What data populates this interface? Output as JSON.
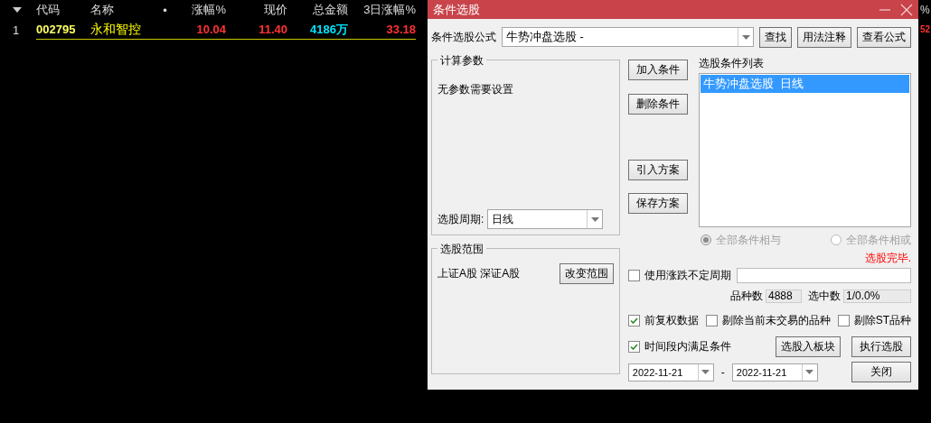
{
  "table": {
    "columns": [
      "代码",
      "名称",
      "•",
      "涨幅%",
      "现价",
      "总金额",
      "3日涨幅%"
    ],
    "rows": [
      {
        "index": "1",
        "cells": [
          "002795",
          "永和智控",
          "",
          "10.04",
          "11.40",
          "4186万",
          "33.18"
        ]
      }
    ],
    "column_8": {
      "header": "%",
      "value": "52"
    }
  },
  "dialog": {
    "title": "条件选股",
    "formula_label": "条件选股公式",
    "formula_value": "牛势冲盘选股 -",
    "top_buttons": [
      "查找",
      "用法注释",
      "查看公式"
    ],
    "params_group": {
      "title": "计算参数",
      "text": "无参数需要设置",
      "period_label": "选股周期:",
      "period_value": "日线"
    },
    "action_buttons": [
      "加入条件",
      "删除条件",
      "引入方案",
      "保存方案"
    ],
    "conditions": {
      "label": "选股条件列表",
      "items": [
        {
          "text": "牛势冲盘选股  日线",
          "selected": true
        }
      ]
    },
    "logic_disabled": true,
    "logic_options": [
      {
        "label": "全部条件相与",
        "selected": true
      },
      {
        "label": "全部条件相或",
        "selected": false
      }
    ],
    "status": "选股完毕.",
    "range_group": {
      "title": "选股范围",
      "text": "上证A股 深证A股",
      "button": "改变范围"
    },
    "variable_period": {
      "label": "使用涨跌不定周期",
      "checked": false
    },
    "counts": [
      {
        "label": "品种数",
        "value": "4888"
      },
      {
        "label": "选中数",
        "value": "1/0.0%"
      }
    ],
    "options": [
      {
        "label": "前复权数据",
        "checked": true
      },
      {
        "label": "剔除当前未交易的品种",
        "checked": false
      },
      {
        "label": "剔除ST品种",
        "checked": false
      }
    ],
    "time_range": {
      "label": "时间段内满足条件",
      "checked": true
    },
    "bottom_buttons": [
      "选股入板块",
      "执行选股"
    ],
    "date_from": "2022-11-21",
    "separator": "-",
    "date_to": "2022-11-21",
    "close_button": "关闭"
  }
}
